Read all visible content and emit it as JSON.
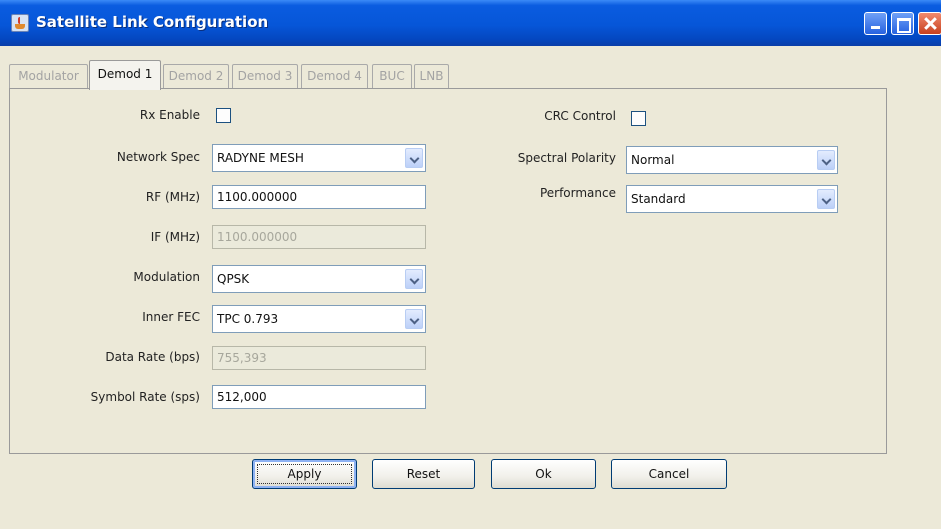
{
  "window": {
    "title": "Satellite Link Configuration"
  },
  "tabs": [
    {
      "label": "Modulator",
      "active": false
    },
    {
      "label": "Demod 1",
      "active": true
    },
    {
      "label": "Demod 2",
      "active": false
    },
    {
      "label": "Demod 3",
      "active": false
    },
    {
      "label": "Demod 4",
      "active": false
    },
    {
      "label": "BUC",
      "active": false
    },
    {
      "label": "LNB",
      "active": false
    }
  ],
  "left_form": {
    "rx_enable": {
      "label": "Rx Enable",
      "checked": false
    },
    "network_spec": {
      "label": "Network Spec",
      "value": "RADYNE MESH"
    },
    "rf_mhz": {
      "label": "RF (MHz)",
      "value": "1100.000000"
    },
    "if_mhz": {
      "label": "IF (MHz)",
      "value": "1100.000000",
      "disabled": true
    },
    "modulation": {
      "label": "Modulation",
      "value": "QPSK"
    },
    "inner_fec": {
      "label": "Inner FEC",
      "value": "TPC 0.793"
    },
    "data_rate": {
      "label": "Data Rate (bps)",
      "value": "755,393",
      "disabled": true
    },
    "symbol_rate": {
      "label": "Symbol Rate (sps)",
      "value": "512,000"
    }
  },
  "right_form": {
    "crc_control": {
      "label": "CRC Control",
      "checked": false
    },
    "spectral_polarity": {
      "label": "Spectral Polarity",
      "value": "Normal"
    },
    "performance": {
      "label": "Performance",
      "value": "Standard"
    }
  },
  "buttons": {
    "apply": "Apply",
    "reset": "Reset",
    "ok": "Ok",
    "cancel": "Cancel"
  },
  "colors": {
    "title_bar": "#0656d8",
    "window_bg": "#ece9d8",
    "input_border": "#7f9db9"
  }
}
